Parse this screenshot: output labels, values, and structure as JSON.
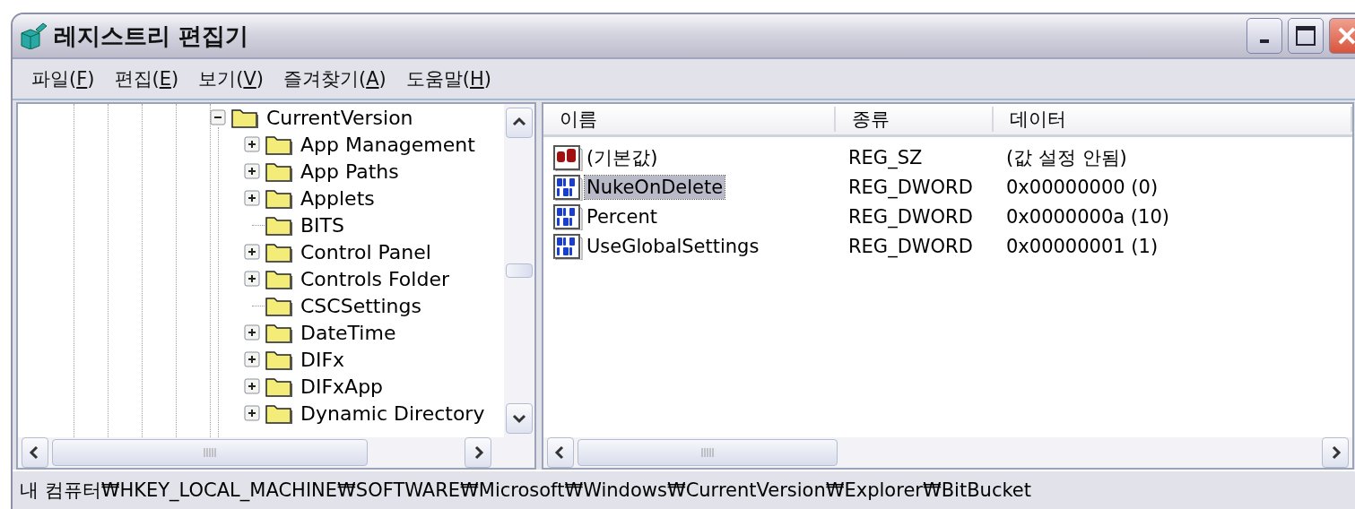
{
  "window": {
    "title": "레지스트리 편집기"
  },
  "menu": [
    {
      "before": "파일(",
      "key": "F",
      "after": ")"
    },
    {
      "before": "편집(",
      "key": "E",
      "after": ")"
    },
    {
      "before": "보기(",
      "key": "V",
      "after": ")"
    },
    {
      "before": "즐겨찾기(",
      "key": "A",
      "after": ")"
    },
    {
      "before": "도움말(",
      "key": "H",
      "after": ")"
    }
  ],
  "tree": [
    {
      "label": "CurrentVersion",
      "expanded": true,
      "selected": false,
      "children": [
        {
          "label": "App Management",
          "expandable": true,
          "selected": false
        },
        {
          "label": "App Paths",
          "expandable": true,
          "selected": false
        },
        {
          "label": "Applets",
          "expandable": true,
          "selected": false
        },
        {
          "label": "BITS",
          "expandable": false,
          "selected": false
        },
        {
          "label": "Control Panel",
          "expandable": true,
          "selected": false
        },
        {
          "label": "Controls Folder",
          "expandable": true,
          "selected": false
        },
        {
          "label": "CSCSettings",
          "expandable": false,
          "selected": false
        },
        {
          "label": "DateTime",
          "expandable": true,
          "selected": false
        },
        {
          "label": "DIFx",
          "expandable": true,
          "selected": false
        },
        {
          "label": "DIFxApp",
          "expandable": true,
          "selected": false
        },
        {
          "label": "Dynamic Directory",
          "expandable": true,
          "selected": false
        }
      ]
    }
  ],
  "values": {
    "columns": [
      "이름",
      "종류",
      "데이터"
    ],
    "rows": [
      {
        "name": "(기본값)",
        "type": "REG_SZ",
        "data": "(값 설정 안됨)",
        "kind": "string",
        "selected": false
      },
      {
        "name": "NukeOnDelete",
        "type": "REG_DWORD",
        "data": "0x00000000 (0)",
        "kind": "binary",
        "selected": true
      },
      {
        "name": "Percent",
        "type": "REG_DWORD",
        "data": "0x0000000a (10)",
        "kind": "binary",
        "selected": false
      },
      {
        "name": "UseGlobalSettings",
        "type": "REG_DWORD",
        "data": "0x00000001 (1)",
        "kind": "binary",
        "selected": false
      }
    ]
  },
  "status_bar": "내 컴퓨터₩HKEY_LOCAL_MACHINE₩SOFTWARE₩Microsoft₩Windows₩CurrentVersion₩Explorer₩BitBucket"
}
